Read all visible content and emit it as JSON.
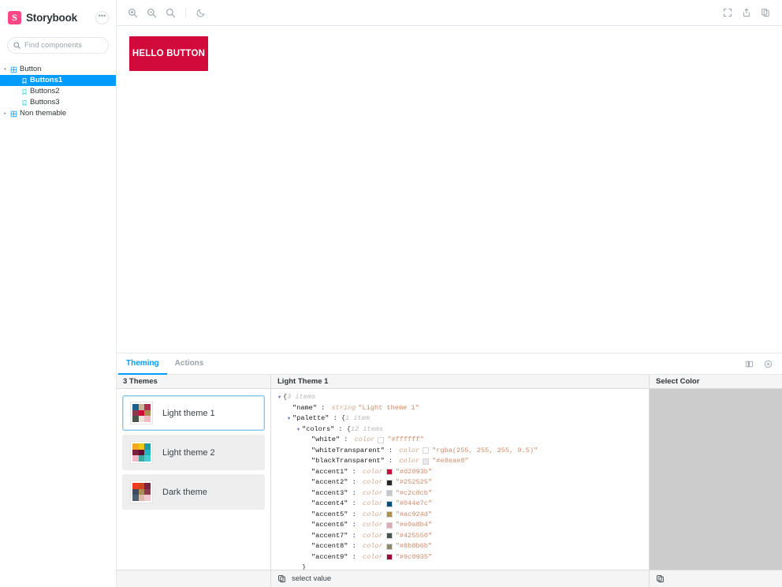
{
  "sidebar": {
    "brand": "Storybook",
    "logo_letter": "S",
    "logo_color": "#ff4785",
    "menu_icon": "ellipsis-icon",
    "search": {
      "placeholder": "Find components",
      "value": "",
      "shortcut": "/"
    },
    "tree": [
      {
        "label": "Button",
        "type": "component",
        "depth": 0,
        "expanded": true,
        "selected": false
      },
      {
        "label": "Buttons1",
        "type": "story",
        "depth": 1,
        "expanded": false,
        "selected": true
      },
      {
        "label": "Buttons2",
        "type": "story",
        "depth": 1,
        "expanded": false,
        "selected": false
      },
      {
        "label": "Buttons3",
        "type": "story",
        "depth": 1,
        "expanded": false,
        "selected": false
      },
      {
        "label": "Non themable",
        "type": "component",
        "depth": 0,
        "expanded": false,
        "selected": false
      }
    ]
  },
  "toolbar": {
    "left_buttons": [
      {
        "name": "zoom-in-icon",
        "title": "Zoom in"
      },
      {
        "name": "zoom-out-icon",
        "title": "Zoom out"
      },
      {
        "name": "zoom-reset-icon",
        "title": "Reset zoom"
      },
      {
        "name": "moon-icon",
        "title": "Toggle dark mode"
      }
    ],
    "right_buttons": [
      {
        "name": "fullscreen-icon",
        "title": "Go full screen"
      },
      {
        "name": "open-in-new-tab-icon",
        "title": "Open canvas in new tab"
      },
      {
        "name": "copy-link-icon",
        "title": "Copy canvas link"
      }
    ]
  },
  "preview": {
    "button_label": "HELLO BUTTON",
    "button_color": "#d2093b",
    "button_text_color": "#ffffff"
  },
  "addon": {
    "tabs": [
      {
        "label": "Theming",
        "active": true
      },
      {
        "label": "Actions",
        "active": false
      }
    ],
    "right_icons": [
      {
        "name": "panel-position-icon",
        "title": "Change addon orientation"
      },
      {
        "name": "close-panel-icon",
        "title": "Hide addons"
      }
    ]
  },
  "themes_panel": {
    "header": "3 Themes",
    "themes": [
      {
        "name": "Light theme 1",
        "selected": true,
        "swatches": [
          "#1f5f8b",
          "#c7b59a",
          "#b03050",
          "#8b3a4e",
          "#d2093b",
          "#a88c52",
          "#4b5550",
          "#eae3da",
          "#f2b8c6"
        ]
      },
      {
        "name": "Light theme 2",
        "selected": false,
        "swatches": [
          "#f5a623",
          "#f0c419",
          "#1f9aa8",
          "#7a1f3d",
          "#5c0f2e",
          "#1fb6c4",
          "#f2b8c6",
          "#3aa99f",
          "#3fd0d6"
        ]
      },
      {
        "name": "Dark theme",
        "selected": false,
        "swatches": [
          "#f03b20",
          "#cf4520",
          "#7a2340",
          "#3d4a63",
          "#a88c52",
          "#8b3a4e",
          "#4b5f6e",
          "#d9b8a8",
          "#f2c9d2"
        ]
      }
    ]
  },
  "json_panel": {
    "header": "Light Theme 1",
    "footer_label": "select value",
    "footer_icon": "copy-icon",
    "rows": [
      {
        "indent": 0,
        "caret": "down",
        "text_parts": [
          {
            "t": "brace",
            "v": "{"
          },
          {
            "t": "count",
            "v": "3 items"
          }
        ]
      },
      {
        "indent": 1,
        "caret": "none",
        "text_parts": [
          {
            "t": "key",
            "v": "\"name\""
          },
          {
            "t": "plain",
            "v": " : "
          },
          {
            "t": "type",
            "v": "string"
          },
          {
            "t": "str",
            "v": "\"Light theme 1\""
          }
        ]
      },
      {
        "indent": 1,
        "caret": "down",
        "text_parts": [
          {
            "t": "key",
            "v": "\"palette\""
          },
          {
            "t": "plain",
            "v": " : "
          },
          {
            "t": "brace",
            "v": "{"
          },
          {
            "t": "count",
            "v": "1 item"
          }
        ]
      },
      {
        "indent": 2,
        "caret": "down",
        "text_parts": [
          {
            "t": "key",
            "v": "\"colors\""
          },
          {
            "t": "plain",
            "v": " : "
          },
          {
            "t": "brace",
            "v": "{"
          },
          {
            "t": "count",
            "v": "12 items"
          }
        ]
      },
      {
        "indent": 3,
        "caret": "none",
        "text_parts": [
          {
            "t": "key",
            "v": "\"white\""
          },
          {
            "t": "plain",
            "v": " : "
          },
          {
            "t": "type",
            "v": "color"
          },
          {
            "t": "chip",
            "v": "#ffffff"
          },
          {
            "t": "str",
            "v": "\"#ffffff\""
          }
        ]
      },
      {
        "indent": 3,
        "caret": "none",
        "text_parts": [
          {
            "t": "key",
            "v": "\"whiteTransparent\""
          },
          {
            "t": "plain",
            "v": " : "
          },
          {
            "t": "type",
            "v": "color"
          },
          {
            "t": "chip",
            "v": "rgba(255,255,255,0.5)"
          },
          {
            "t": "str",
            "v": "\"rgba(255, 255, 255, 0.5)\""
          }
        ]
      },
      {
        "indent": 3,
        "caret": "none",
        "text_parts": [
          {
            "t": "key",
            "v": "\"blackTransparent\""
          },
          {
            "t": "plain",
            "v": " : "
          },
          {
            "t": "type",
            "v": "color"
          },
          {
            "t": "chip",
            "v": "#e8eae8"
          },
          {
            "t": "str",
            "v": "\"#e8eae8\""
          }
        ]
      },
      {
        "indent": 3,
        "caret": "none",
        "text_parts": [
          {
            "t": "key",
            "v": "\"accent1\""
          },
          {
            "t": "plain",
            "v": " : "
          },
          {
            "t": "type",
            "v": "color"
          },
          {
            "t": "chip",
            "v": "#d2093b"
          },
          {
            "t": "str",
            "v": "\"#d2093b\""
          }
        ]
      },
      {
        "indent": 3,
        "caret": "none",
        "text_parts": [
          {
            "t": "key",
            "v": "\"accent2\""
          },
          {
            "t": "plain",
            "v": " : "
          },
          {
            "t": "type",
            "v": "color"
          },
          {
            "t": "chip",
            "v": "#252525"
          },
          {
            "t": "str",
            "v": "\"#252525\""
          }
        ]
      },
      {
        "indent": 3,
        "caret": "none",
        "text_parts": [
          {
            "t": "key",
            "v": "\"accent3\""
          },
          {
            "t": "plain",
            "v": " : "
          },
          {
            "t": "type",
            "v": "color"
          },
          {
            "t": "chip",
            "v": "#c2c8cb"
          },
          {
            "t": "str",
            "v": "\"#c2c8cb\""
          }
        ]
      },
      {
        "indent": 3,
        "caret": "none",
        "text_parts": [
          {
            "t": "key",
            "v": "\"accent4\""
          },
          {
            "t": "plain",
            "v": " : "
          },
          {
            "t": "type",
            "v": "color"
          },
          {
            "t": "chip",
            "v": "#044e7c"
          },
          {
            "t": "str",
            "v": "\"#044e7c\""
          }
        ]
      },
      {
        "indent": 3,
        "caret": "none",
        "text_parts": [
          {
            "t": "key",
            "v": "\"accent5\""
          },
          {
            "t": "plain",
            "v": " : "
          },
          {
            "t": "type",
            "v": "color"
          },
          {
            "t": "chip",
            "v": "#ac924d"
          },
          {
            "t": "str",
            "v": "\"#ac924d\""
          }
        ]
      },
      {
        "indent": 3,
        "caret": "none",
        "text_parts": [
          {
            "t": "key",
            "v": "\"accent6\""
          },
          {
            "t": "plain",
            "v": " : "
          },
          {
            "t": "type",
            "v": "color"
          },
          {
            "t": "chip",
            "v": "#e0a8b4"
          },
          {
            "t": "str",
            "v": "\"#e0a8b4\""
          }
        ]
      },
      {
        "indent": 3,
        "caret": "none",
        "text_parts": [
          {
            "t": "key",
            "v": "\"accent7\""
          },
          {
            "t": "plain",
            "v": " : "
          },
          {
            "t": "type",
            "v": "color"
          },
          {
            "t": "chip",
            "v": "#425550"
          },
          {
            "t": "str",
            "v": "\"#425550\""
          }
        ]
      },
      {
        "indent": 3,
        "caret": "none",
        "text_parts": [
          {
            "t": "key",
            "v": "\"accent8\""
          },
          {
            "t": "plain",
            "v": " : "
          },
          {
            "t": "type",
            "v": "color"
          },
          {
            "t": "chip",
            "v": "#8b8b6b"
          },
          {
            "t": "str",
            "v": "\"#8b8b6b\""
          }
        ]
      },
      {
        "indent": 3,
        "caret": "none",
        "text_parts": [
          {
            "t": "key",
            "v": "\"accent9\""
          },
          {
            "t": "plain",
            "v": " : "
          },
          {
            "t": "type",
            "v": "color"
          },
          {
            "t": "chip",
            "v": "#9c0935"
          },
          {
            "t": "str",
            "v": "\"#9c0935\""
          }
        ]
      },
      {
        "indent": 2,
        "caret": "none",
        "text_parts": [
          {
            "t": "brace",
            "v": "}"
          }
        ]
      },
      {
        "indent": 1,
        "caret": "none",
        "text_parts": [
          {
            "t": "brace",
            "v": "}"
          }
        ]
      }
    ]
  },
  "color_panel": {
    "header": "Select Color",
    "footer_icon": "copy-icon"
  }
}
